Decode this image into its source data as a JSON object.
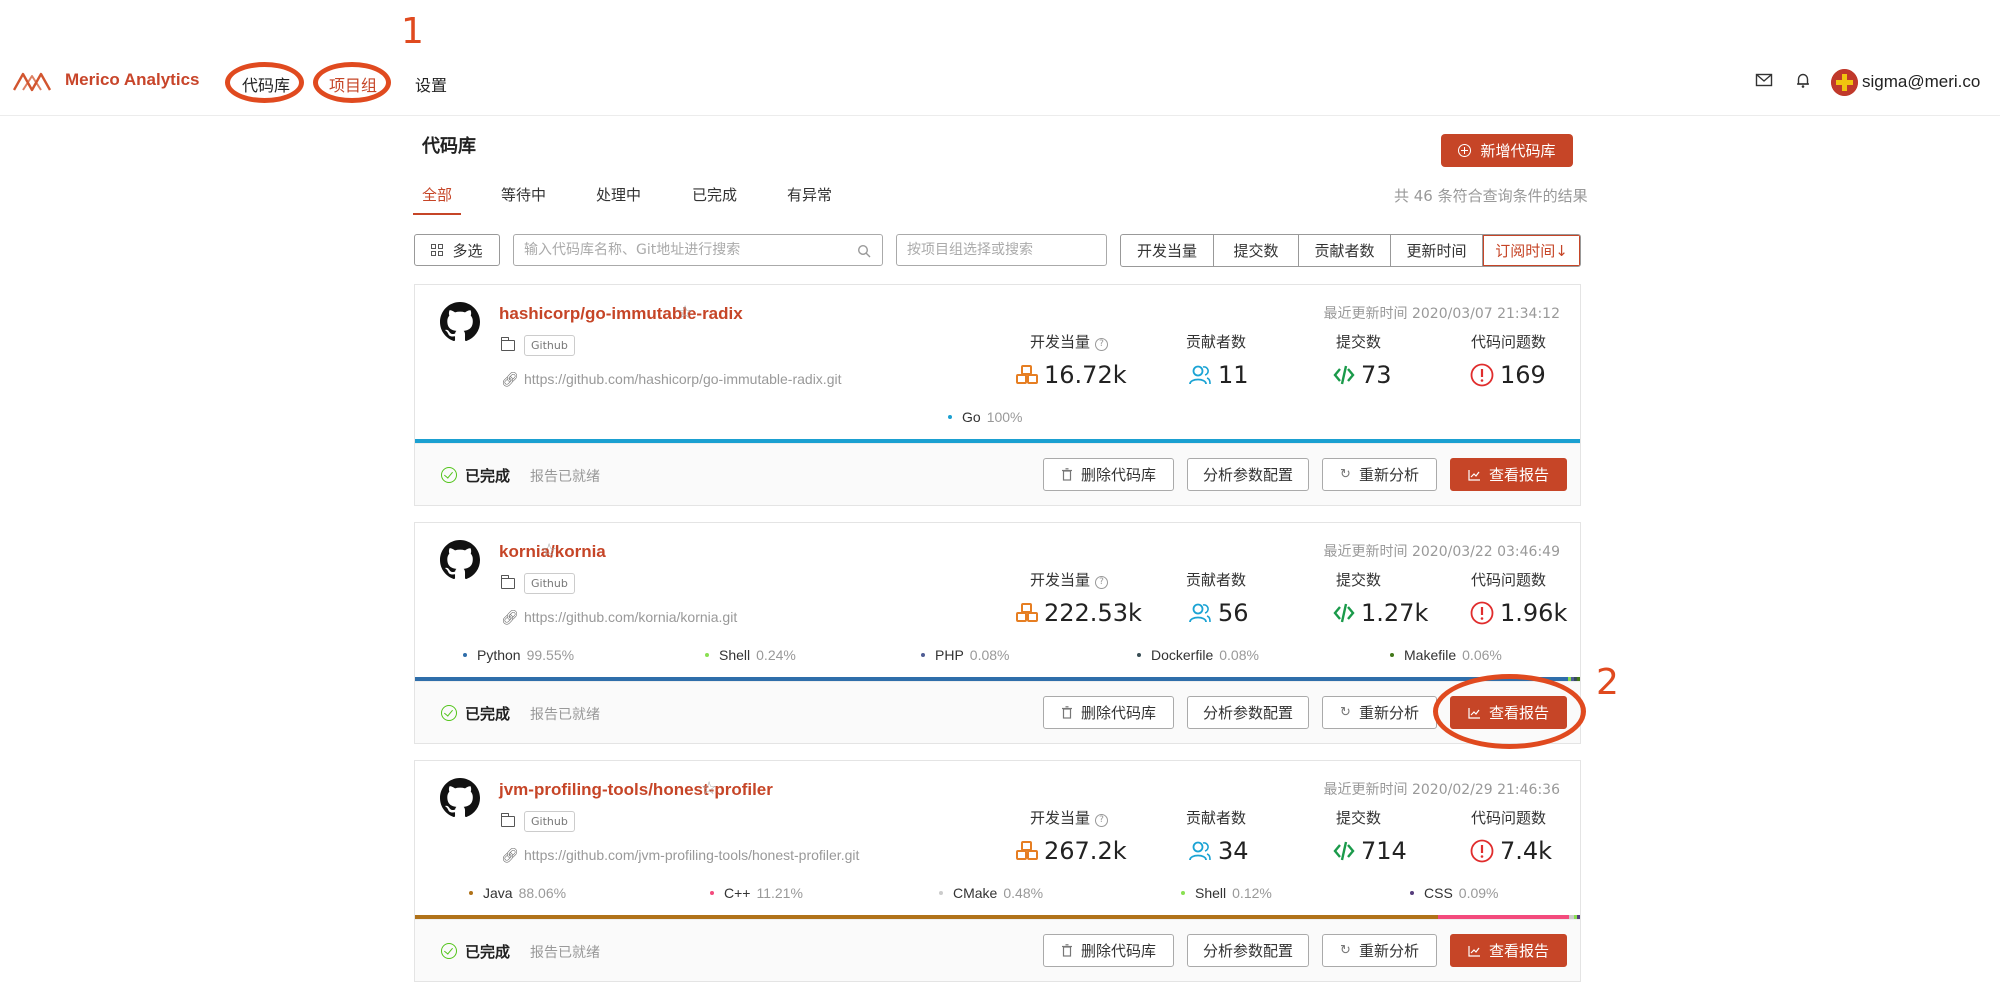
{
  "app": {
    "brand": "Merico Analytics",
    "user_email": "sigma@meri.co"
  },
  "nav": {
    "items": [
      "代码库",
      "项目组",
      "设置"
    ]
  },
  "annotations": {
    "marker_1": "1",
    "marker_2": "2"
  },
  "page": {
    "title": "代码库",
    "add_button": "新增代码库",
    "tabs": [
      "全部",
      "等待中",
      "处理中",
      "已完成",
      "有异常"
    ],
    "active_tab": "全部",
    "result_count": "共 46 条符合查询条件的结果"
  },
  "filters": {
    "multi_select": "多选",
    "search_placeholder": "输入代码库名称、Git地址进行搜索",
    "group_placeholder": "按项目组选择或搜索",
    "sort_options": [
      "开发当量",
      "提交数",
      "贡献者数",
      "更新时间",
      "订阅时间↓"
    ],
    "active_sort": "订阅时间↓"
  },
  "labels": {
    "dev_equiv": "开发当量",
    "contributors": "贡献者数",
    "commits": "提交数",
    "issues": "代码问题数",
    "status_done": "已完成",
    "report_ready": "报告已就绪",
    "delete_repo": "删除代码库",
    "config": "分析参数配置",
    "reanalyze": "重新分析",
    "view_report": "查看报告"
  },
  "colors": {
    "brand": "#c64527",
    "annotation": "#e04a1f",
    "done": "#52c41a",
    "dev_icon": "#e67e22",
    "contrib_icon": "#1aa3d4",
    "commit_icon": "#1a9a4a",
    "issue_icon": "#e02d2d"
  },
  "repos": [
    {
      "name": "hashicorp/go-immutable-radix",
      "source": "Github",
      "url": "https://github.com/hashicorp/go-immutable-radix.git",
      "updated": "最近更新时间 2020/03/07 21:34:12",
      "dev_equiv": "16.72k",
      "contributors": "11",
      "commits": "73",
      "issues": "169",
      "languages": [
        {
          "name": "Go",
          "pct": "100%",
          "share": 100,
          "color": "#1ba0d1"
        }
      ]
    },
    {
      "name": "kornia/kornia",
      "source": "Github",
      "url": "https://github.com/kornia/kornia.git",
      "updated": "最近更新时间 2020/03/22 03:46:49",
      "dev_equiv": "222.53k",
      "contributors": "56",
      "commits": "1.27k",
      "issues": "1.96k",
      "languages": [
        {
          "name": "Python",
          "pct": "99.55%",
          "share": 99.55,
          "color": "#2f6eaa"
        },
        {
          "name": "Shell",
          "pct": "0.24%",
          "share": 0.24,
          "color": "#89e051"
        },
        {
          "name": "PHP",
          "pct": "0.08%",
          "share": 0.08,
          "color": "#4f5d95"
        },
        {
          "name": "Dockerfile",
          "pct": "0.08%",
          "share": 0.08,
          "color": "#384d54"
        },
        {
          "name": "Makefile",
          "pct": "0.06%",
          "share": 0.06,
          "color": "#427819"
        }
      ]
    },
    {
      "name": "jvm-profiling-tools/honest-profiler",
      "source": "Github",
      "url": "https://github.com/jvm-profiling-tools/honest-profiler.git",
      "updated": "最近更新时间 2020/02/29 21:46:36",
      "dev_equiv": "267.2k",
      "contributors": "34",
      "commits": "714",
      "issues": "7.4k",
      "languages": [
        {
          "name": "Java",
          "pct": "88.06%",
          "share": 88.06,
          "color": "#b07219"
        },
        {
          "name": "C++",
          "pct": "11.21%",
          "share": 11.21,
          "color": "#f34b7d"
        },
        {
          "name": "CMake",
          "pct": "0.48%",
          "share": 0.48,
          "color": "#cccccc"
        },
        {
          "name": "Shell",
          "pct": "0.12%",
          "share": 0.12,
          "color": "#89e051"
        },
        {
          "name": "CSS",
          "pct": "0.09%",
          "share": 0.09,
          "color": "#563d7c"
        }
      ]
    }
  ]
}
